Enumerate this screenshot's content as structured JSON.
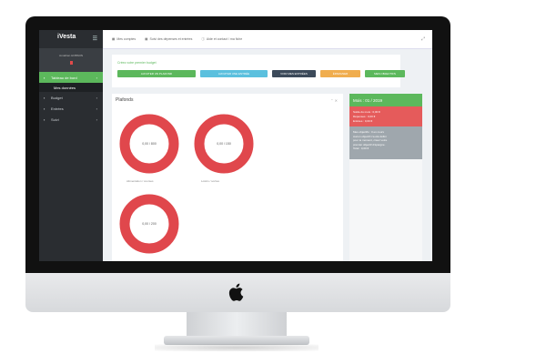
{
  "brand": "iVesta",
  "user": {
    "name": "Jonathan HOBSON",
    "badge": "1"
  },
  "sidebar": {
    "items": [
      {
        "label": "Tableau de bord",
        "icon": "home-icon",
        "active": true
      },
      {
        "label": "Budget",
        "icon": "wallet-icon",
        "active": false
      },
      {
        "label": "Entrées",
        "icon": "list-icon",
        "active": false
      },
      {
        "label": "Suivi",
        "icon": "chart-icon",
        "active": false
      }
    ],
    "sub_item": "Mes données"
  },
  "topbar": {
    "items": [
      "Mes comptes",
      "Suivi des dépenses et entrées",
      "Aide et contact / ma fiche"
    ]
  },
  "actions": {
    "hint": "Créez votre premier budget",
    "buttons": [
      {
        "label": "AJOUTER UN PLAFOND",
        "color": "#5cb85c"
      },
      {
        "label": "AJOUTER UNE ENTRÉE",
        "color": "#5bc0de"
      },
      {
        "label": "VOIR MES ENTRÉES",
        "color": "#3c4a5a"
      },
      {
        "label": "ÉPARGNER",
        "color": "#f0ad4e"
      },
      {
        "label": "MES OBJECTIFS",
        "color": "#5cb85c"
      }
    ]
  },
  "main": {
    "title": "Plafonds",
    "donuts": [
      {
        "center": "0,00 / 800",
        "caption": "Alimentation / courses"
      },
      {
        "center": "0,00 / 150",
        "caption": "Loisirs / sorties"
      },
      {
        "center": "0,00 / 200",
        "caption": ""
      }
    ]
  },
  "panel": {
    "header": "Mois : 01 / 2019",
    "alert": [
      "Solde du mois : 0,00 €",
      "Dépenses : 0,00 €",
      "Entrées : 0,00 €"
    ],
    "info": [
      "Mes objectifs : 0 en cours",
      "Aucun objectif n'a été défini",
      "pour le moment, créez votre",
      "premier objectif d'épargne."
    ],
    "total": "Total : 0,00 €"
  },
  "colors": {
    "donut": "#e0474c",
    "accent": "#5cb85c",
    "danger": "#e55b5b"
  }
}
